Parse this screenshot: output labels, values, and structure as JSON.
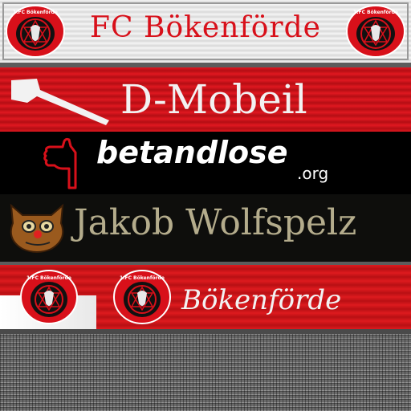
{
  "banners": {
    "fc": {
      "title": "FC Bökenförde",
      "badge_label": "1.FC Bökenförde"
    },
    "sponsor1": {
      "title": "D-Mobeil"
    },
    "sponsor2": {
      "brand": "betandlose",
      "tld": ".org"
    },
    "sponsor3": {
      "title": "Jakob Wolfspelz"
    },
    "flag": {
      "title": "Bökenförde",
      "badge_label": "1.FC Bökenförde"
    }
  },
  "colors": {
    "club_red": "#d8101a",
    "silver": "#eeeeee",
    "black": "#000000",
    "khaki_text": "#b4ac8c"
  }
}
